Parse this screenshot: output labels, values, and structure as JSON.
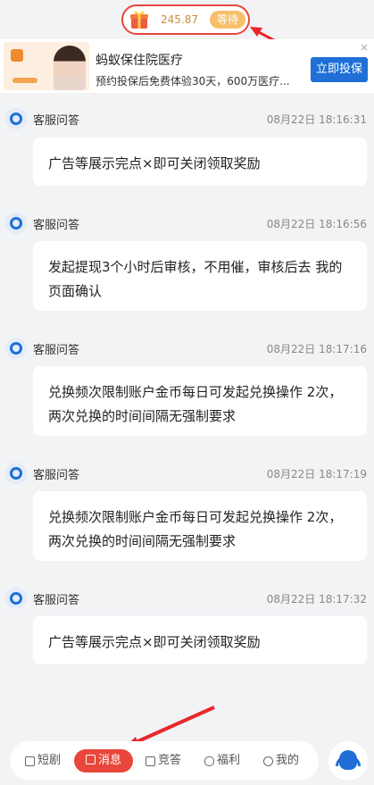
{
  "reward": {
    "amount": "245.87",
    "button": "等待"
  },
  "ad": {
    "title": "蚂蚁保住院医疗",
    "description": "预约投保后免费体验30天，600万医疗...",
    "cta": "立即投保",
    "close": "×"
  },
  "messages": [
    {
      "sender": "客服问答",
      "time": "08月22日 18:16:31",
      "text": "广告等展示完点×即可关闭领取奖励"
    },
    {
      "sender": "客服问答",
      "time": "08月22日 18:16:56",
      "text": "发起提现3个小时后审核，不用催，审核后去 我的 页面确认"
    },
    {
      "sender": "客服问答",
      "time": "08月22日 18:17:16",
      "text": "兑换频次限制账户金币每日可发起兑换操作 2次，两次兑换的时间间隔无强制要求"
    },
    {
      "sender": "客服问答",
      "time": "08月22日 18:17:19",
      "text": "兑换频次限制账户金币每日可发起兑换操作 2次，两次兑换的时间间隔无强制要求"
    },
    {
      "sender": "客服问答",
      "time": "08月22日 18:17:32",
      "text": "广告等展示完点×即可关闭领取奖励"
    }
  ],
  "nav": {
    "items": [
      {
        "label": "短剧",
        "icon": "film-icon"
      },
      {
        "label": "消息",
        "icon": "message-icon",
        "active": true
      },
      {
        "label": "竞答",
        "icon": "quiz-icon"
      },
      {
        "label": "福利",
        "icon": "gift-hand-icon"
      },
      {
        "label": "我的",
        "icon": "person-icon"
      }
    ]
  },
  "colors": {
    "accent": "#e8463a",
    "brand_blue": "#1f6fd6",
    "gold": "#f6c06a"
  }
}
